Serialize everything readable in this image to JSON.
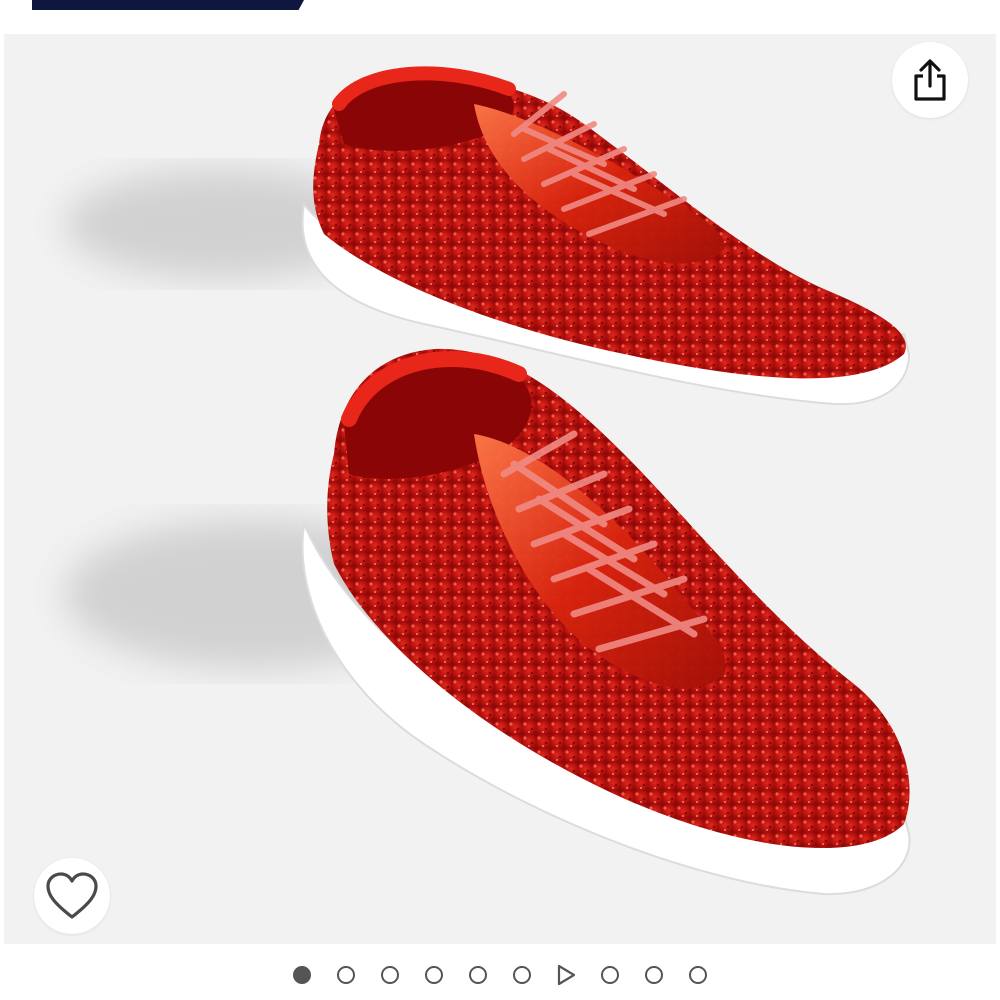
{
  "header": {
    "banner_color": "#0f1640"
  },
  "product_gallery": {
    "image_description_icon": "red-glitter-sneakers-image",
    "background_color": "#f2f2f2",
    "shoe_color": "#c8140f",
    "sole_color": "#ffffff",
    "share_icon": "share-icon",
    "wishlist_icon": "heart-icon"
  },
  "carousel": {
    "total_items": 10,
    "active_index": 0,
    "video_index": 6
  }
}
